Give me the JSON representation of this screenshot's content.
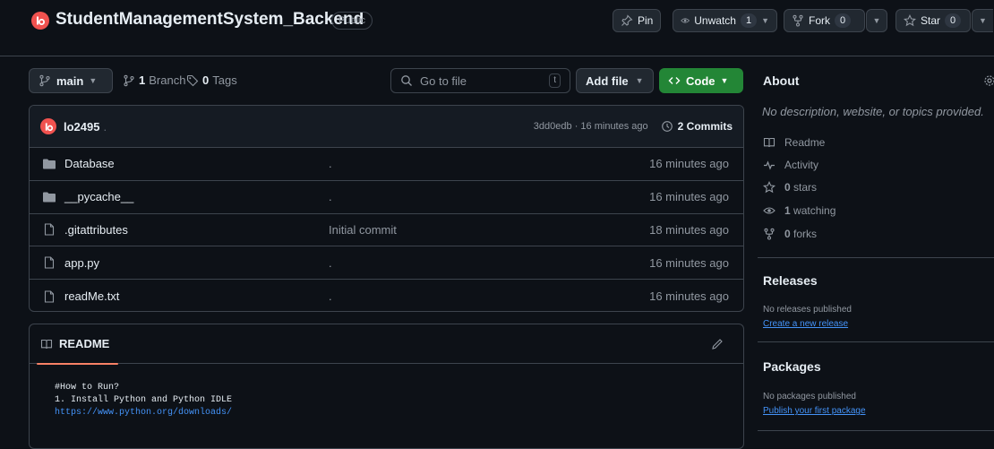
{
  "repo": {
    "name": "StudentManagementSystem_Backend",
    "visibility": "Public"
  },
  "actions": {
    "pin": "Pin",
    "unwatch": "Unwatch",
    "watch_count": "1",
    "fork": "Fork",
    "fork_count": "0",
    "star": "Star",
    "star_count": "0"
  },
  "toolbar": {
    "branch": "main",
    "branches_count": "1",
    "branches_label": "Branch",
    "tags_count": "0",
    "tags_label": "Tags",
    "go_to_file_placeholder": "Go to file",
    "go_to_file_shortcut": "t",
    "add_file": "Add file",
    "code": "Code"
  },
  "latest_commit": {
    "author": "lo2495",
    "message": ".",
    "hash": "3dd0edb",
    "age": "16 minutes ago",
    "separator": "·",
    "commits_label": "2 Commits"
  },
  "files": [
    {
      "name": "Database",
      "type": "folder",
      "message": ".",
      "age": "16 minutes ago"
    },
    {
      "name": "__pycache__",
      "type": "folder",
      "message": ".",
      "age": "16 minutes ago"
    },
    {
      "name": ".gitattributes",
      "type": "file",
      "message": "Initial commit",
      "age": "18 minutes ago"
    },
    {
      "name": "app.py",
      "type": "file",
      "message": ".",
      "age": "16 minutes ago"
    },
    {
      "name": "readMe.txt",
      "type": "file",
      "message": ".",
      "age": "16 minutes ago"
    }
  ],
  "readme": {
    "tab_label": "README",
    "lines": [
      "#How to Run?",
      "1. Install Python and Python IDLE"
    ],
    "link": "https://www.python.org/downloads/"
  },
  "about": {
    "title": "About",
    "description": "No description, website, or topics provided.",
    "readme_label": "Readme",
    "activity_label": "Activity",
    "stars_count": "0",
    "stars_label": "stars",
    "watching_count": "1",
    "watching_label": "watching",
    "forks_count": "0",
    "forks_label": "forks"
  },
  "releases": {
    "title": "Releases",
    "note": "No releases published",
    "link": "Create a new release"
  },
  "packages": {
    "title": "Packages",
    "note": "No packages published",
    "link": "Publish your first package"
  },
  "colors": {
    "background": "#0d1117",
    "border": "#3d444d",
    "muted_text": "#9198a1",
    "code_button": "#238636",
    "link": "#4493f8",
    "avatar": "#f0524f",
    "readme_underline": "#f78166"
  }
}
